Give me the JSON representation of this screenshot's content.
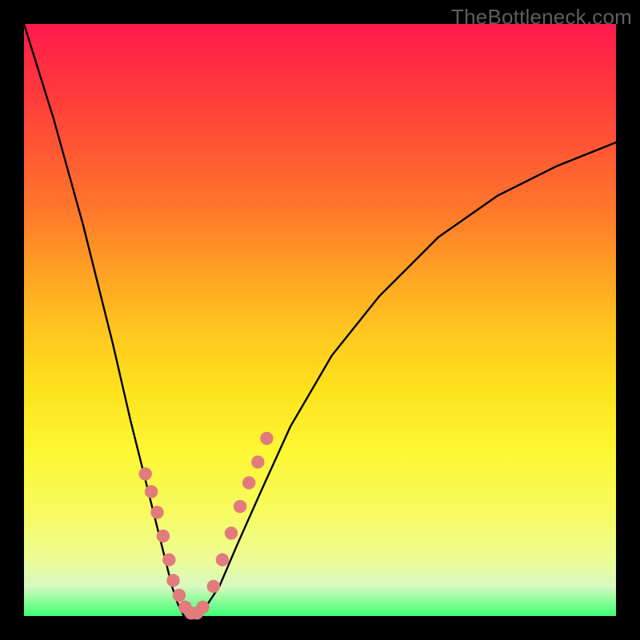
{
  "watermark": "TheBottleneck.com",
  "chart_data": {
    "type": "line",
    "title": "",
    "xlabel": "",
    "ylabel": "",
    "xlim": [
      0,
      1
    ],
    "ylim": [
      0,
      1
    ],
    "note": "No axes or ticks are rendered; values are in normalized plot coordinates (0..1 from bottom-left).",
    "series": [
      {
        "name": "bottleneck-curve",
        "x": [
          0.0,
          0.05,
          0.1,
          0.15,
          0.18,
          0.2,
          0.22,
          0.24,
          0.25,
          0.26,
          0.27,
          0.28,
          0.29,
          0.3,
          0.31,
          0.33,
          0.36,
          0.4,
          0.45,
          0.52,
          0.6,
          0.7,
          0.8,
          0.9,
          1.0
        ],
        "y": [
          1.0,
          0.84,
          0.66,
          0.46,
          0.33,
          0.25,
          0.17,
          0.09,
          0.05,
          0.02,
          0.0,
          0.0,
          0.0,
          0.01,
          0.02,
          0.05,
          0.12,
          0.21,
          0.32,
          0.44,
          0.54,
          0.64,
          0.71,
          0.76,
          0.8
        ]
      }
    ],
    "markers": {
      "name": "highlighted-points",
      "color": "#e27b7b",
      "x": [
        0.205,
        0.215,
        0.225,
        0.235,
        0.245,
        0.252,
        0.262,
        0.272,
        0.282,
        0.292,
        0.302,
        0.32,
        0.335,
        0.35,
        0.365,
        0.38,
        0.395,
        0.41
      ],
      "y": [
        0.24,
        0.21,
        0.175,
        0.135,
        0.095,
        0.06,
        0.035,
        0.015,
        0.005,
        0.005,
        0.015,
        0.05,
        0.095,
        0.14,
        0.185,
        0.225,
        0.26,
        0.3
      ]
    }
  }
}
